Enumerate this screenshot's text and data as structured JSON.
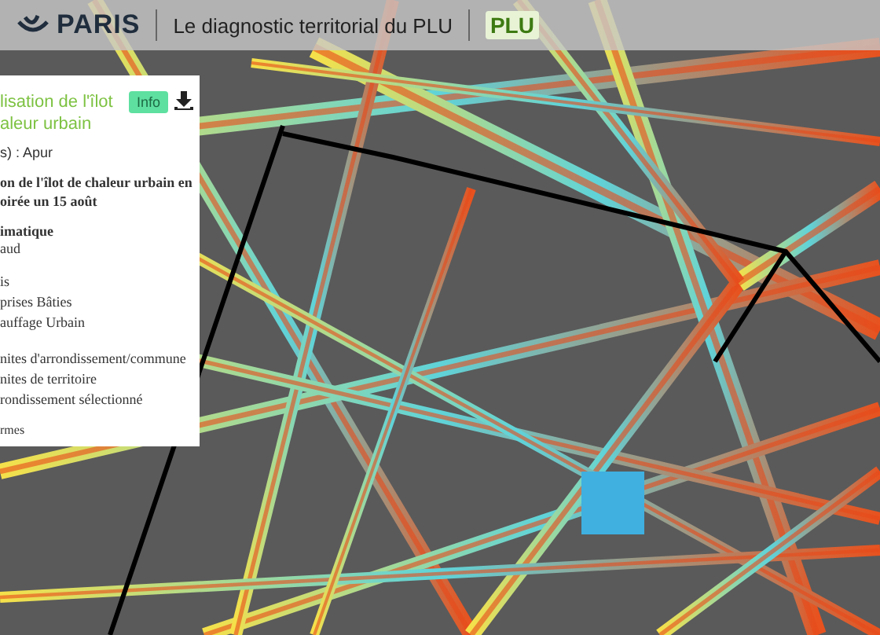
{
  "header": {
    "brand": "PARIS",
    "title": "Le diagnostic territorial du PLU",
    "logo_text": "PLU"
  },
  "panel": {
    "title_lines": [
      "lisation de l'îlot",
      "aleur urbain"
    ],
    "badge": "Info",
    "source": "s) : Apur",
    "subtitle_lines": [
      "on de l'îlot de chaleur urbain en",
      "oirée un 15 août"
    ],
    "section": "imatique",
    "section_items": [
      "aud"
    ],
    "legend_items": [
      "is",
      "prises Bâties",
      "auffage Urbain"
    ],
    "boundary_items": [
      "nites d'arrondissement/commune",
      "nites de territoire",
      "rondissement sélectionné"
    ],
    "footer": "rmes"
  }
}
